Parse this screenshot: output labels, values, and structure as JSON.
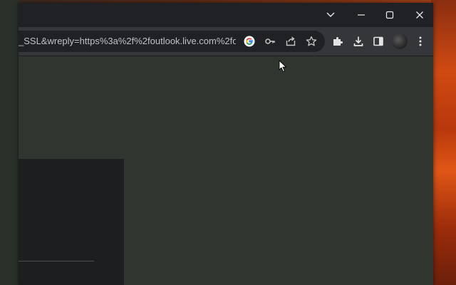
{
  "browser": {
    "url": "_SSL&wreply=https%3a%2f%2foutlook.live.com%2fo...",
    "window_controls": {
      "tab_search": "⌵",
      "minimize": "—",
      "maximize": "☐",
      "close": "✕"
    },
    "omnibox_icons": [
      "google-lens-icon",
      "key-icon",
      "share-icon",
      "star-icon"
    ],
    "toolbar_icons": [
      "extensions-icon",
      "download-icon",
      "side-panel-icon",
      "avatar",
      "menu-icon"
    ]
  },
  "colors": {
    "titlebar": "#1f2124",
    "toolbar": "#35363a",
    "omnibox": "#202124",
    "page_background": "#2f362f",
    "dark_panel": "#1d1e20",
    "wallpaper_accent": "#d04a12"
  }
}
